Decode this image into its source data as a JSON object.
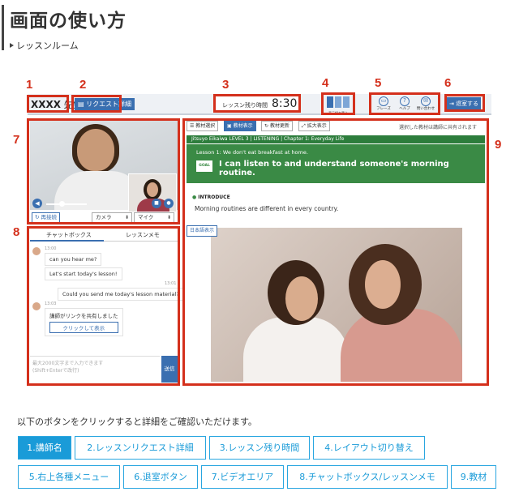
{
  "page": {
    "title": "画面の使い方",
    "subtitle": "レッスンルーム"
  },
  "markers": [
    "1",
    "2",
    "3",
    "4",
    "5",
    "6",
    "7",
    "8",
    "9"
  ],
  "screen": {
    "teacher": {
      "name": "XXXX",
      "suffix": "先生"
    },
    "request_button": "リクエスト詳細",
    "timer": {
      "label": "レッスン残り時間",
      "value": "8:30"
    },
    "layout_toggle_label": "表示切り替え",
    "menu": [
      {
        "icon": "speech-bubble-icon",
        "label": "フレーズ"
      },
      {
        "icon": "help-icon",
        "label": "ヘルプ"
      },
      {
        "icon": "mail-icon",
        "label": "問い合わせ"
      }
    ],
    "leave_button": "退室する",
    "video": {
      "reconnect": "再接続",
      "camera": "カメラ",
      "mic": "マイク"
    },
    "chat": {
      "tabs": [
        "チャットボックス",
        "レッスンメモ"
      ],
      "messages": [
        {
          "time": "13:00",
          "text": "can you hear me?"
        },
        {
          "time": "",
          "text": "Let's start today's lesson!"
        },
        {
          "time": "13:01",
          "text": "Could you send me today's lesson material?"
        },
        {
          "time": "13:03",
          "text": "講師がリンクを共有しました",
          "button": "クリックして表示"
        }
      ],
      "input_placeholder": "最大2000文字まで入力できます\n(Shift+Enterで改行)",
      "send": "送信"
    },
    "material": {
      "toolbar": [
        "教材選択",
        "教材表示",
        "教材更新",
        "拡大表示"
      ],
      "shared_note": "選択した教材は講師に共有されます",
      "level_bar": "Jitsuyo Eikaiwa LEVEL 3 | LISTENING | Chapter 1: Everyday Life",
      "lesson_title": "Lesson 1: We don't eat breakfast at home.",
      "goal_label": "GOAL",
      "goal_text": "I can listen to and understand someone's morning routine.",
      "intro_label": "INTRODUCE",
      "intro_text": "Morning routines are different in every country.",
      "jp_button": "日本語表示"
    }
  },
  "instructions": "以下のボタンをクリックすると詳細をご確認いただけます。",
  "nav_buttons": [
    {
      "label": "1.講師名",
      "active": true
    },
    {
      "label": "2.レッスンリクエスト詳細",
      "active": false
    },
    {
      "label": "3.レッスン残り時間",
      "active": false
    },
    {
      "label": "4.レイアウト切り替え",
      "active": false
    },
    {
      "label": "5.右上各種メニュー",
      "active": false
    },
    {
      "label": "6.退室ボタン",
      "active": false
    },
    {
      "label": "7.ビデオエリア",
      "active": false
    },
    {
      "label": "8.チャットボックス/レッスンメモ",
      "active": false
    },
    {
      "label": "9.教材",
      "active": false
    }
  ],
  "colors": {
    "accent": "#1a9bd8",
    "marker": "#d4301c",
    "app_blue": "#3a6fb0",
    "green": "#3a8a45"
  }
}
